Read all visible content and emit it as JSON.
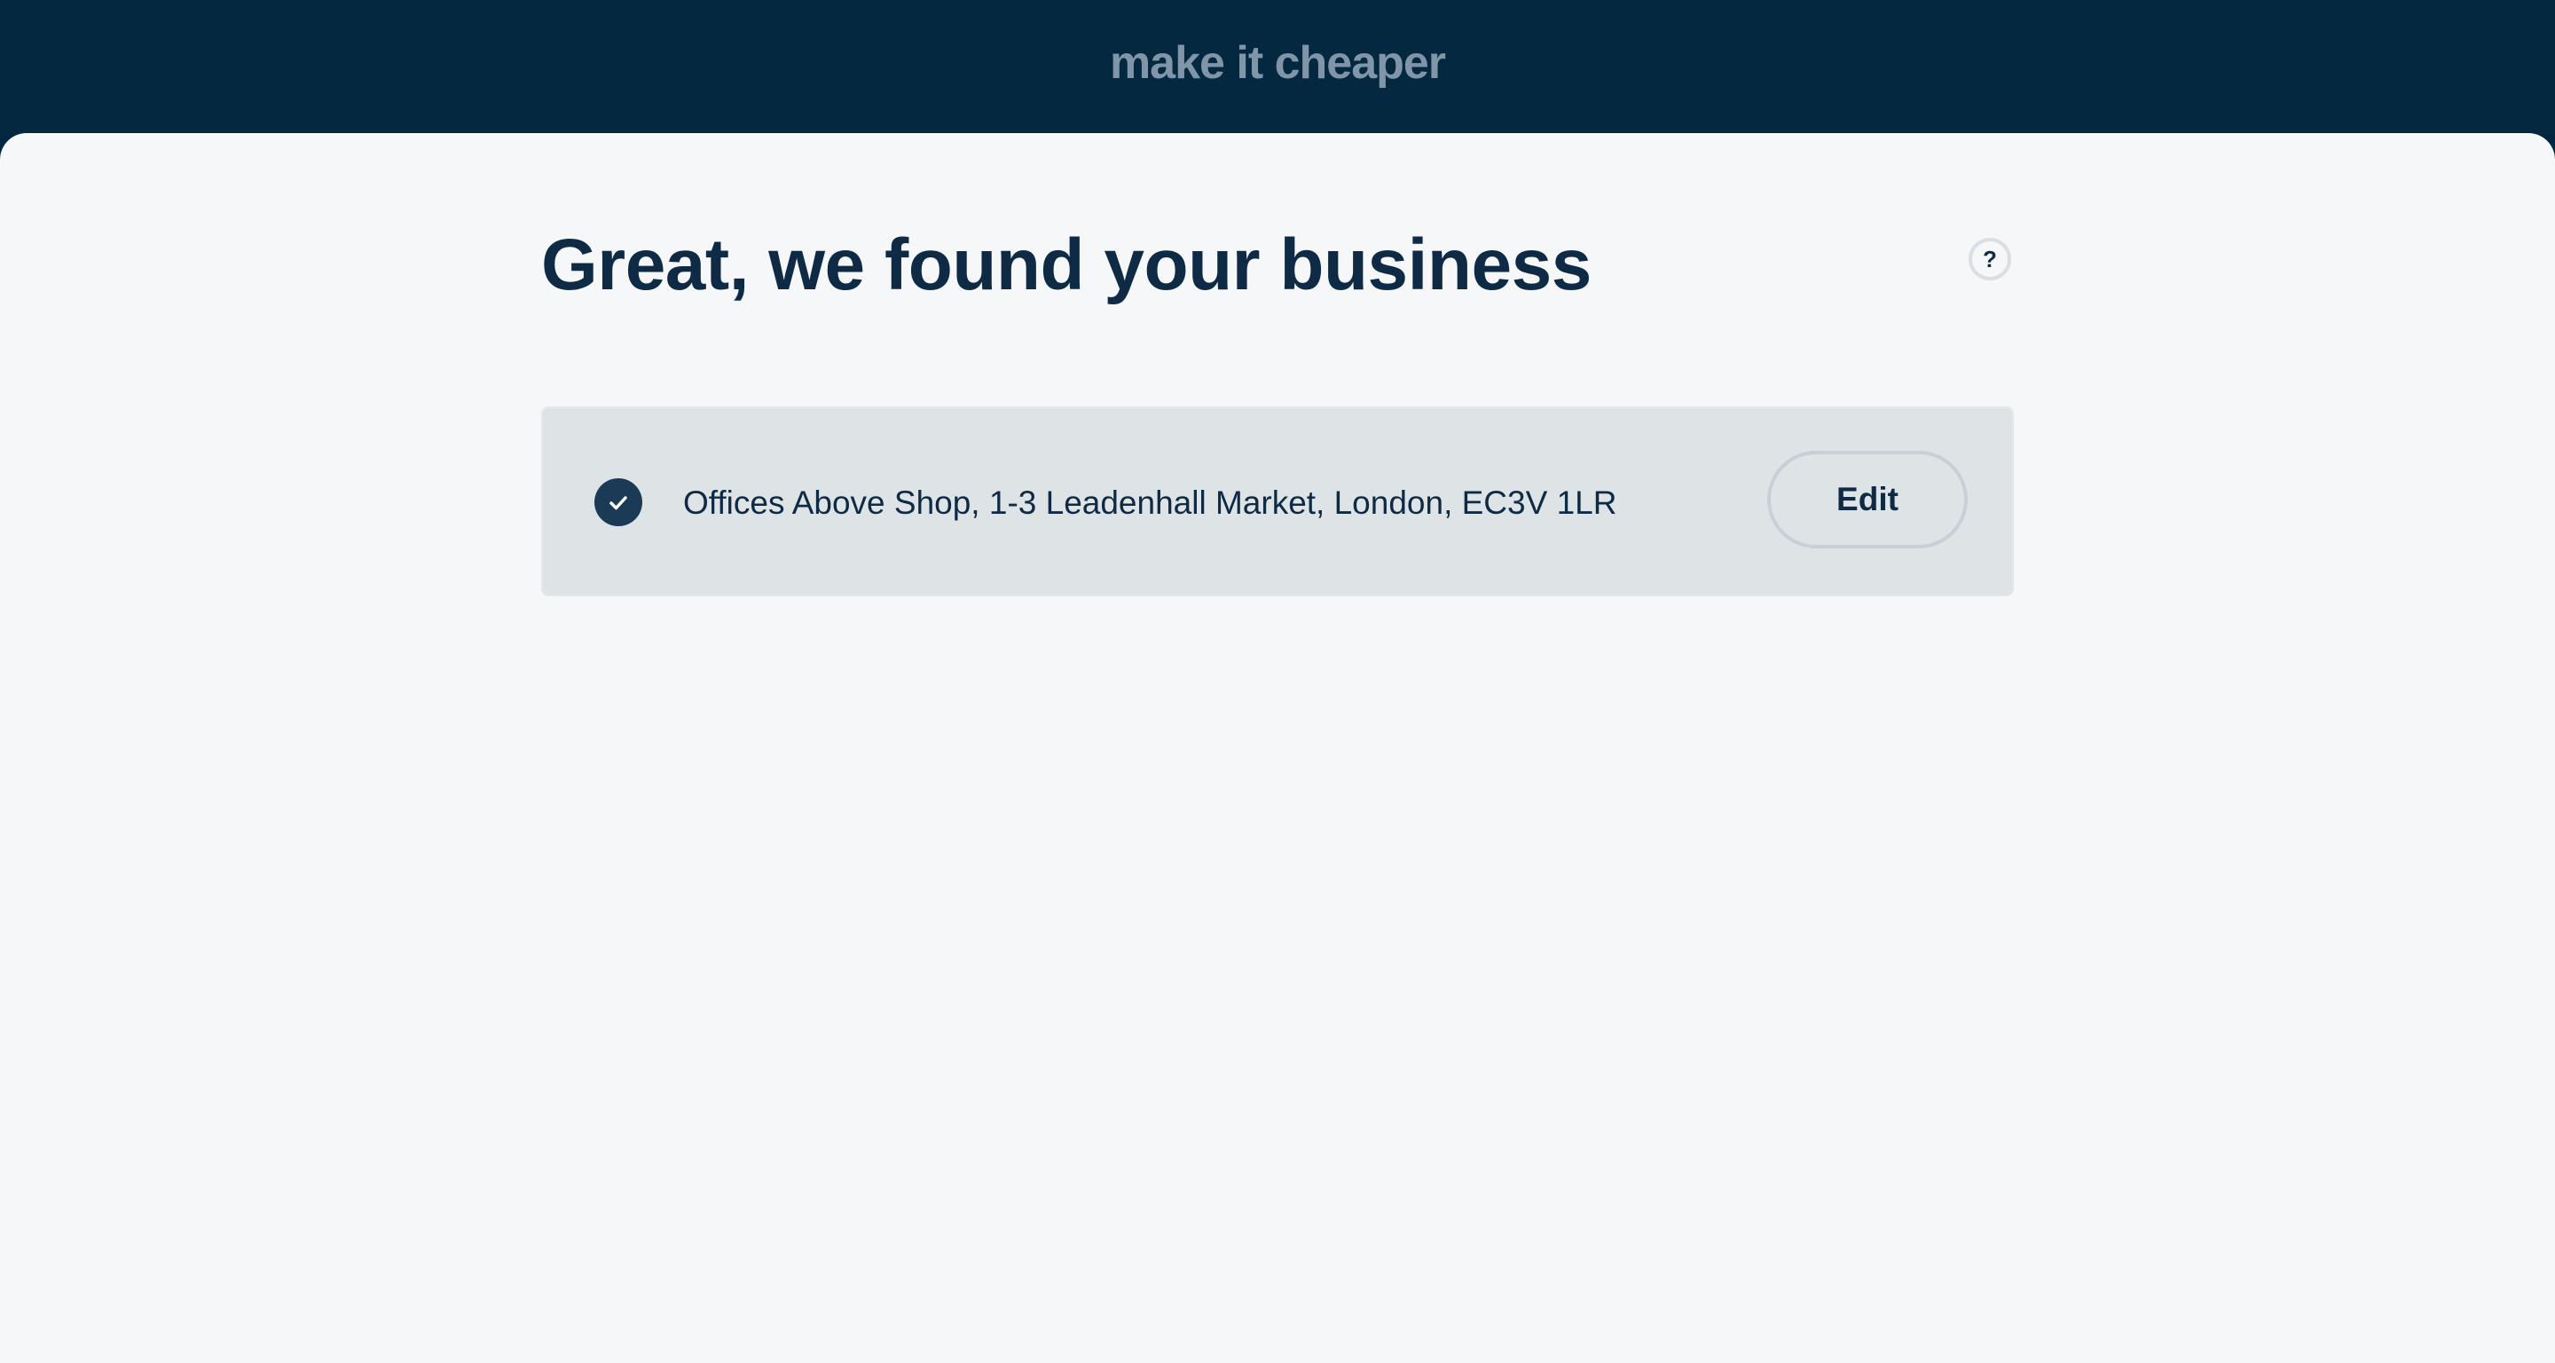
{
  "brand": {
    "logo_text": "make it cheaper"
  },
  "page": {
    "title": "Great, we found your business",
    "help_label": "?"
  },
  "business": {
    "address": "Offices Above Shop, 1-3 Leadenhall Market, London, EC3V 1LR",
    "status_icon": "check-circle-icon",
    "edit_label": "Edit"
  },
  "colors": {
    "header_bg": "#032840",
    "page_bg": "#f6f7f9",
    "card_bg": "#dee3e6",
    "text_primary": "#0e2a45",
    "logo_text": "#8096a8"
  }
}
